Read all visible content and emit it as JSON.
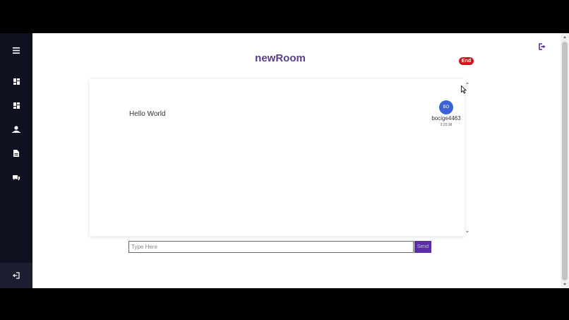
{
  "sidebar": {
    "icons": [
      "menu-icon",
      "dashboard-icon",
      "dashboard-icon",
      "user-icon",
      "document-icon",
      "chat-icon",
      "logout-icon"
    ]
  },
  "header": {
    "room_title": "newRoom",
    "end_label": "End"
  },
  "chat": {
    "messages": [
      {
        "text": "Hello World",
        "avatar_initials": "BO",
        "username": "bocige4463",
        "time": "2:20:38"
      }
    ]
  },
  "composer": {
    "placeholder": "Type Here",
    "send_label": "Send"
  },
  "colors": {
    "sidebar": "#0f1020",
    "accent": "#5a2ea6",
    "title": "#5a3c8a",
    "end_badge": "#c8191c",
    "avatar": "#3b63d6"
  }
}
